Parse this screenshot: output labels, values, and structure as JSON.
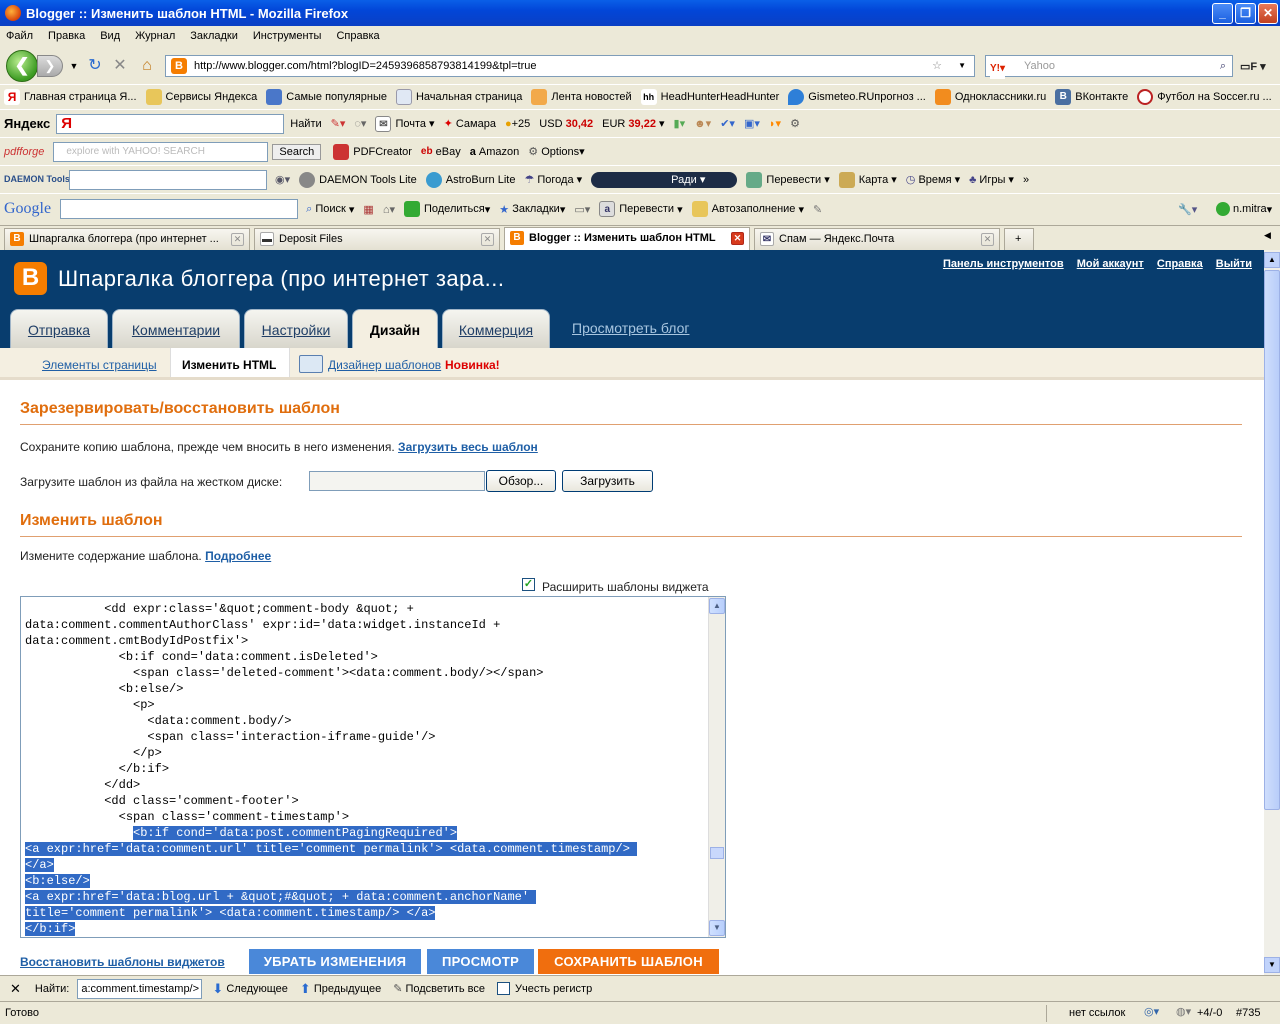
{
  "window": {
    "title": "Blogger :: Изменить шаблон HTML - Mozilla Firefox"
  },
  "menu": [
    "Файл",
    "Правка",
    "Вид",
    "Журнал",
    "Закладки",
    "Инструменты",
    "Справка"
  ],
  "nav": {
    "url": "http://www.blogger.com/html?blogID=2459396858793814199&tpl=true",
    "search_placeholder": "Yahoo"
  },
  "bookmarks": [
    "Главная страница Я...",
    "Сервисы Яндекса",
    "Самые популярные",
    "Начальная страница",
    "Лента новостей",
    "HeadHunterHeadHunter",
    "Gismeteo.RUпрогноз ...",
    "Одноклассники.ru",
    "ВКонтакте",
    "Футбол на Soccer.ru ..."
  ],
  "yandex_bar": {
    "brand": "Яндекс",
    "search_btn": "Найти",
    "mail": "Почта",
    "city": "Самара",
    "temp": "+25",
    "usd_label": "USD",
    "usd": "30,42",
    "eur_label": "EUR",
    "eur": "39,22"
  },
  "pdfforge_bar": {
    "brand": "pdfforge",
    "search_placeholder": "explore with YAHOO! SEARCH",
    "search_btn": "Search",
    "items": [
      "PDFCreator",
      "eBay",
      "Amazon",
      "Options"
    ]
  },
  "daemon_bar": {
    "brand": "DAEMON Tools",
    "items": [
      "DAEMON Tools Lite",
      "AstroBurn Lite",
      "Погода",
      "Ради",
      "Перевести",
      "Карта",
      "Время",
      "Игры"
    ]
  },
  "google_bar": {
    "brand": "Google",
    "items": [
      "Поиск",
      "Поделиться",
      "Закладки",
      "Перевести",
      "Автозаполнение"
    ],
    "user": "n.mitra"
  },
  "tabs": [
    {
      "label": "Шпаргалка блоггера (про интернет ..."
    },
    {
      "label": "Deposit Files"
    },
    {
      "label": "Blogger :: Изменить шаблон HTML"
    },
    {
      "label": "Спам — Яндекс.Почта"
    }
  ],
  "blogger": {
    "blog_title": "Шпаргалка блоггера (про интернет зара...",
    "top_links": [
      "Панель инструментов",
      "Мой аккаунт",
      "Справка",
      "Выйти"
    ],
    "main_tabs": [
      "Отправка",
      "Комментарии",
      "Настройки",
      "Дизайн",
      "Коммерция"
    ],
    "view_blog": "Просмотреть блог",
    "sub_tabs": {
      "elements": "Элементы страницы",
      "edit_html": "Изменить HTML",
      "designer": "Дизайнер шаблонов",
      "new": "Новинка!"
    },
    "backup": {
      "heading": "Зарезервировать/восстановить шаблон",
      "text": "Сохраните копию шаблона, прежде чем вносить в него изменения.",
      "download_link": "Загрузить весь шаблон",
      "upload_label": "Загрузите шаблон из файла на жестком диске:",
      "browse_btn": "Обзор...",
      "upload_btn": "Загрузить"
    },
    "edit": {
      "heading": "Изменить шаблон",
      "text": "Измените содержание шаблона.",
      "more_link": "Подробнее",
      "expand_label": "Расширить шаблоны виджета"
    },
    "code_lines": [
      {
        "t": "           <dd expr:class='&quot;comment-body &quot; +",
        "s": false
      },
      {
        "t": "data:comment.commentAuthorClass' expr:id='data:widget.instanceId +",
        "s": false
      },
      {
        "t": "data:comment.cmtBodyIdPostfix'>",
        "s": false
      },
      {
        "t": "             <b:if cond='data:comment.isDeleted'>",
        "s": false
      },
      {
        "t": "               <span class='deleted-comment'><data:comment.body/></span>",
        "s": false
      },
      {
        "t": "             <b:else/>",
        "s": false
      },
      {
        "t": "               <p>",
        "s": false
      },
      {
        "t": "                 <data:comment.body/>",
        "s": false
      },
      {
        "t": "                 <span class='interaction-iframe-guide'/>",
        "s": false
      },
      {
        "t": "               </p>",
        "s": false
      },
      {
        "t": "             </b:if>",
        "s": false
      },
      {
        "t": "           </dd>",
        "s": false
      },
      {
        "t": "           <dd class='comment-footer'>",
        "s": false
      },
      {
        "t": "             <span class='comment-timestamp'>",
        "s": false
      },
      {
        "t": "               <b:if cond='data:post.commentPagingRequired'>",
        "s": "partial",
        "pre": "               ",
        "sel": "<b:if cond='data:post.commentPagingRequired'>"
      },
      {
        "t": "<a expr:href='data:comment.url' title='comment permalink'> <data.comment.timestamp/> ",
        "s": true
      },
      {
        "t": "</a>",
        "s": true
      },
      {
        "t": "<b:else/>",
        "s": true
      },
      {
        "t": "<a expr:href='data:blog.url + &quot;#&quot; + data:comment.anchorName' ",
        "s": true
      },
      {
        "t": "title='comment permalink'> <data:comment.timestamp/> </a>",
        "s": true
      },
      {
        "t": "</b:if>",
        "s": true
      }
    ],
    "restore_link": "Восстановить шаблоны виджетов",
    "buttons": {
      "discard": "УБРАТЬ ИЗМЕНЕНИЯ",
      "preview": "ПРОСМОТР",
      "save": "СОХРАНИТЬ ШАБЛОН"
    }
  },
  "findbar": {
    "label": "Найти:",
    "value": "a:comment.timestamp/>",
    "next": "Следующее",
    "prev": "Предыдущее",
    "highlight": "Подсветить все",
    "match_case": "Учесть регистр"
  },
  "status": {
    "text": "Готово",
    "links": "нет ссылок",
    "counter": "+4/-0",
    "tag": "#735"
  },
  "colors": {
    "blogger_header": "#083d6e",
    "orange": "#e06e0e",
    "button_blue": "#4a88d9",
    "button_orange": "#f06e0e",
    "selection": "#316ac5"
  }
}
